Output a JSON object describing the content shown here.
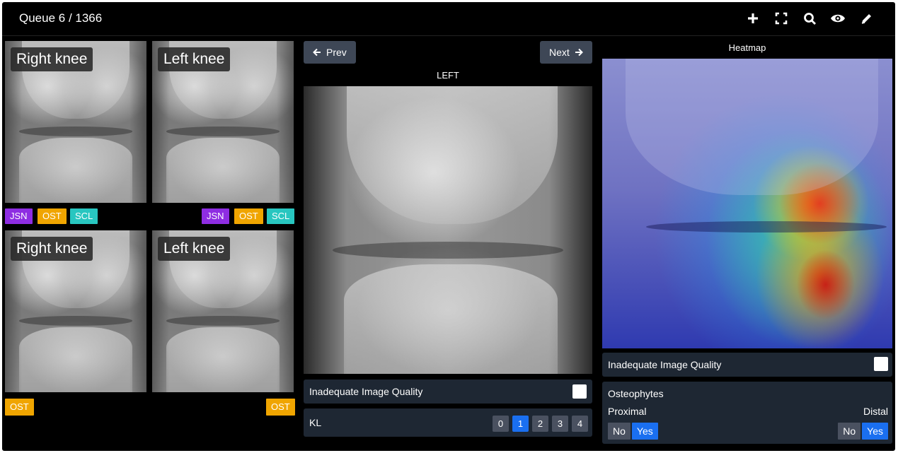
{
  "header": {
    "queue_label": "Queue 6 / 1366"
  },
  "toolbar": {
    "icons": [
      "plus-icon",
      "fullscreen-icon",
      "search-icon",
      "eye-icon",
      "pencil-icon"
    ]
  },
  "thumbnails": [
    {
      "label": "Right knee",
      "tags": [
        "JSN",
        "OST",
        "SCL"
      ]
    },
    {
      "label": "Left knee",
      "tags": [
        "JSN",
        "OST",
        "SCL"
      ]
    },
    {
      "label": "Right knee",
      "tags": [
        "OST"
      ]
    },
    {
      "label": "Left knee",
      "tags": [
        "OST"
      ]
    }
  ],
  "viewer": {
    "prev_label": "Prev",
    "next_label": "Next",
    "side_label": "LEFT",
    "quality_label": "Inadequate Image Quality",
    "kl_label": "KL",
    "kl_options": [
      "0",
      "1",
      "2",
      "3",
      "4"
    ],
    "kl_selected": "1"
  },
  "heatmap": {
    "title": "Heatmap",
    "quality_label": "Inadequate Image Quality",
    "osteophytes_label": "Osteophytes",
    "proximal_label": "Proximal",
    "distal_label": "Distal",
    "no_label": "No",
    "yes_label": "Yes",
    "proximal_value": "Yes",
    "distal_value": "Yes"
  },
  "colors": {
    "jsn": "#8e2de2",
    "ost": "#f0a500",
    "scl": "#28c6c0",
    "accent": "#1a6ff0",
    "panel": "#1e2733"
  }
}
